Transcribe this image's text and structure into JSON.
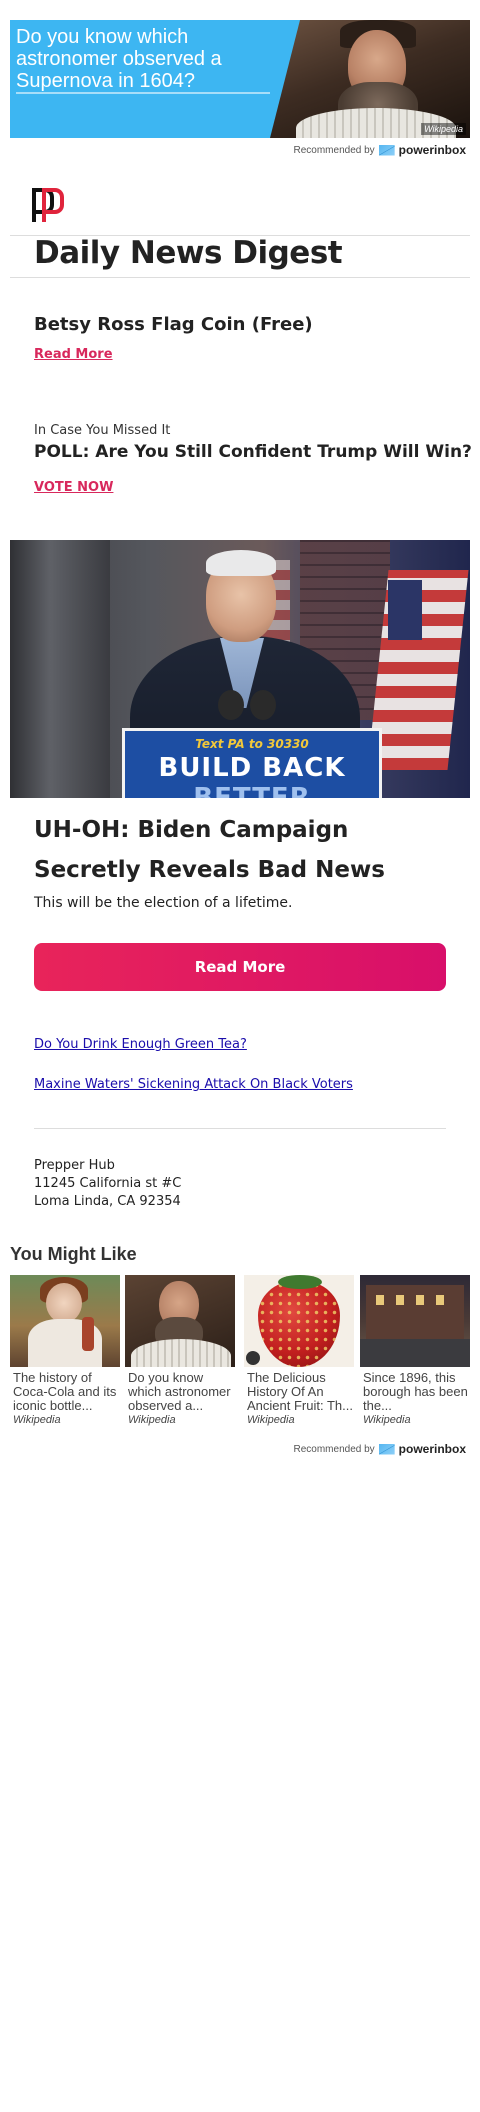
{
  "top_ad": {
    "text": "Do you know which astronomer observed a Supernova in 1604?",
    "source": "Wikipedia"
  },
  "recommended": {
    "label": "Recommended by",
    "brand": "powerinbox"
  },
  "newsletter": {
    "title": "Daily News Digest"
  },
  "item1": {
    "headline": "Betsy Ross Flag Coin (Free)",
    "link": "Read More"
  },
  "item2": {
    "kicker": "In Case You Missed It",
    "headline": "POLL: Are You Still Confident Trump Will Win?",
    "link": "VOTE NOW"
  },
  "hero": {
    "sign_top": "Text PA to 30330",
    "sign_main": "BUILD BACK",
    "sign_sub": "BETTER"
  },
  "main_story": {
    "headline": "UH-OH: Biden Campaign Secretly Reveals Bad News",
    "subtext": "This will be the election of a lifetime.",
    "button": "Read More"
  },
  "links": [
    "Do You Drink Enough Green Tea?",
    "Maxine Waters' Sickening Attack On Black Voters"
  ],
  "address": {
    "name": "Prepper Hub",
    "street": "11245 California st #C",
    "city": "Loma Linda, CA 92354"
  },
  "you_might_like": {
    "title": "You Might Like",
    "cards": [
      {
        "caption": "The history of Coca-Cola and its iconic bottle...",
        "source": "Wikipedia"
      },
      {
        "caption": "Do you know which astronomer observed a...",
        "source": "Wikipedia"
      },
      {
        "caption": "The Delicious History Of An Ancient Fruit: Th...",
        "source": "Wikipedia"
      },
      {
        "caption": "Since 1896, this borough has been the...",
        "source": "Wikipedia"
      }
    ]
  },
  "colors": {
    "accent_pink": "#d8285c",
    "ad_blue": "#3db6f2",
    "link_blue": "#1a0dab"
  }
}
